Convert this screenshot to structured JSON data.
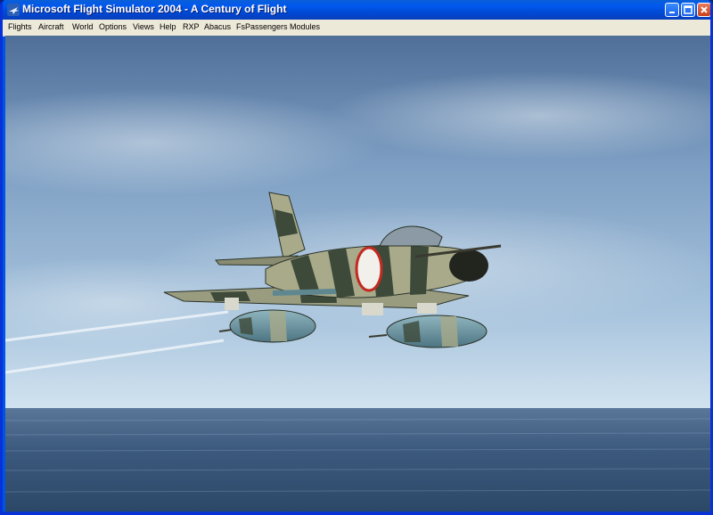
{
  "window": {
    "title": "Microsoft Flight Simulator 2004 - A Century of Flight",
    "app_icon": "fs-airplane-icon",
    "controls": [
      "minimize-icon",
      "maximize-icon",
      "close-icon"
    ]
  },
  "menu": {
    "items": [
      {
        "label": "Flights"
      },
      {
        "label": "Aircraft"
      },
      {
        "label": "World"
      },
      {
        "label": "Options"
      },
      {
        "label": "Views"
      },
      {
        "label": "Help"
      },
      {
        "label": "RXP"
      },
      {
        "label": "Abacus"
      },
      {
        "label": "FsPassengers"
      },
      {
        "label": "Modules"
      }
    ]
  },
  "scene": {
    "description_colors": {
      "sky_top": "#5b7aa4",
      "sky_mid": "#8fb1d2",
      "horizon": "#c9dcea",
      "sea": "#3c5a7e",
      "camo_light": "#a8aa8a",
      "camo_dark": "#3d4a3a",
      "tank": "#6f9aa6"
    }
  }
}
